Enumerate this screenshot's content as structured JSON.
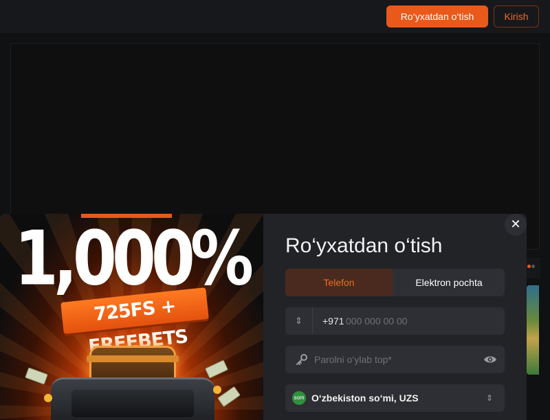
{
  "header": {
    "register_label": "Ro‘yxatdan o‘tish",
    "login_label": "Kirish"
  },
  "promo": {
    "headline": "1,000%",
    "subline": "725FS + FREEBETS"
  },
  "modal": {
    "title": "Ro‘yxatdan o‘tish",
    "close_symbol": "✕",
    "tabs": [
      {
        "label": "Telefon",
        "active": true
      },
      {
        "label": "Elektron pochta",
        "active": false
      }
    ],
    "phone": {
      "selector_symbol": "⇕",
      "code": "+971",
      "placeholder": "000 000 00 00"
    },
    "password": {
      "placeholder": "Parolni o‘ylab top*"
    },
    "currency": {
      "badge": "som",
      "label": "O‘zbekiston so‘mi, UZS",
      "arrows": "⇕"
    }
  },
  "colors": {
    "accent": "#e8591a",
    "background": "#101112",
    "panel": "#222327"
  },
  "icons": [
    "key-icon",
    "eye-icon",
    "close-icon",
    "sort-arrows-icon"
  ]
}
